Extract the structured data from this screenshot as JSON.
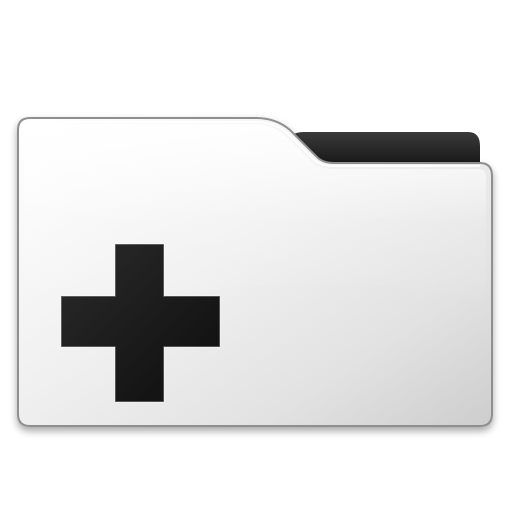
{
  "icon": {
    "name": "folder-add-icon",
    "description_glyphs": [
      "folder-icon",
      "plus-icon"
    ],
    "colors": {
      "folder_face_light": "#ffffff",
      "folder_face_mid": "#e9e9e9",
      "folder_face_dark": "#cfcfcf",
      "folder_edge": "#9a9a9a",
      "folder_back": "#1a1a1a",
      "plus_fill": "#151515",
      "plus_highlight": "#3a3a3a"
    }
  }
}
